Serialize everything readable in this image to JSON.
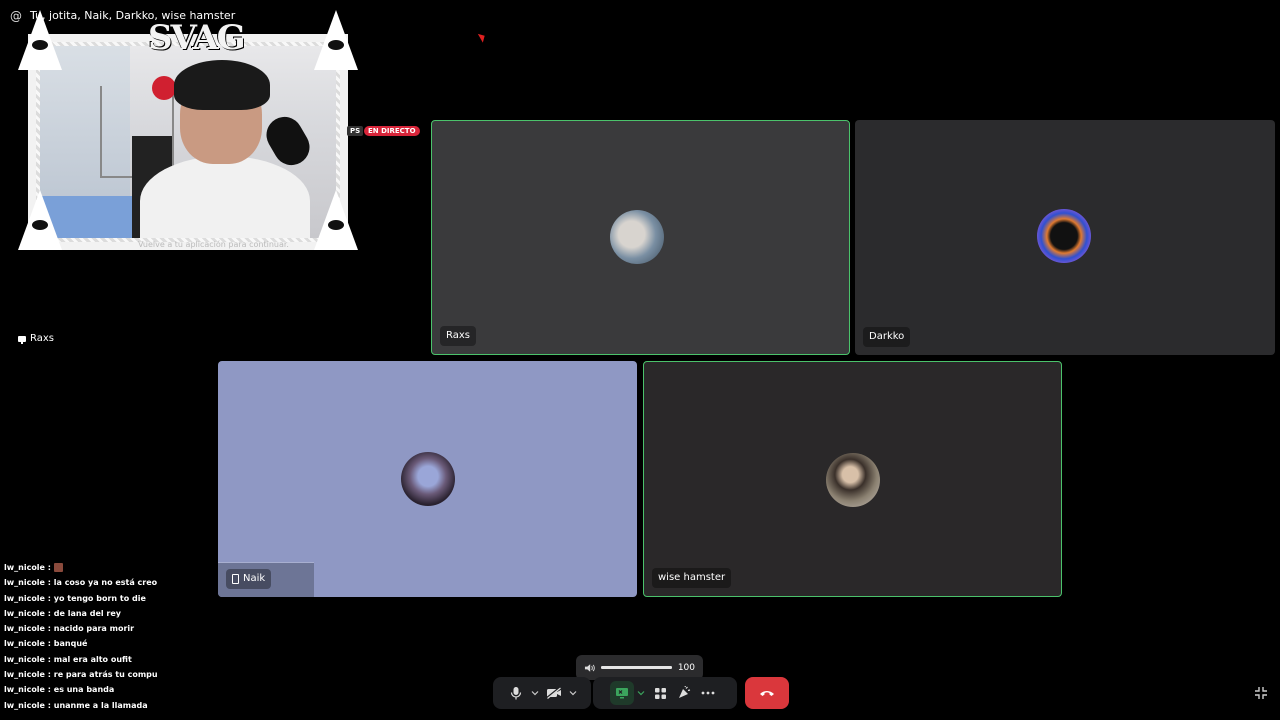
{
  "window": {
    "at_symbol": "@",
    "title": "Tu, jotita, Naik, Darkko, wise hamster"
  },
  "stream_overlay": {
    "logo_text": "SVAG",
    "caption": "Vuelve a tu aplicación para continuar.",
    "badge_ps": "PS",
    "badge_live": "EN DIRECTO",
    "streamer_label": "Raxs"
  },
  "tiles": [
    {
      "name": "Raxs",
      "speaking": true,
      "bg": "#3a3a3c"
    },
    {
      "name": "Darkko",
      "speaking": false,
      "bg": "#2b2b2d"
    },
    {
      "name": "Naik",
      "speaking": false,
      "bg": "#8f98c4",
      "device": "phone-icon"
    },
    {
      "name": "wise hamster",
      "speaking": true,
      "bg": "#2a2829"
    }
  ],
  "chat": [
    {
      "user": "lw_nicole",
      "sep": " : ",
      "text": "",
      "emoji": true
    },
    {
      "user": "lw_nicole",
      "sep": " : ",
      "text": "la coso ya no está creo"
    },
    {
      "user": "lw_nicole",
      "sep": " : ",
      "text": "yo tengo born to die"
    },
    {
      "user": "lw_nicole",
      "sep": " : ",
      "text": "de lana del rey"
    },
    {
      "user": "lw_nicole",
      "sep": " : ",
      "text": "nacido para morir"
    },
    {
      "user": "lw_nicole",
      "sep": " : ",
      "text": "banqué"
    },
    {
      "user": "lw_nicole",
      "sep": " : ",
      "text": "mal era alto oufit"
    },
    {
      "user": "lw_nicole",
      "sep": " : ",
      "text": "re para atrás tu compu"
    },
    {
      "user": "lw_nicole",
      "sep": " : ",
      "text": "es una banda"
    },
    {
      "user": "lw_nicole",
      "sep": " : ",
      "text": "unanme a la llamada"
    }
  ],
  "volume": {
    "value": "100",
    "level": 1.0
  },
  "controls": {
    "audio": [
      "microphone-icon",
      "chevron-down-icon",
      "camera-off-icon",
      "chevron-down-icon"
    ],
    "share": [
      "screen-share-icon",
      "chevron-down-icon",
      "activities-icon",
      "soundboard-icon",
      "more-icon"
    ],
    "hangup": "phone-hangup-icon",
    "collapse": "collapse-icon"
  },
  "colors": {
    "speaking_border": "#4bc26b",
    "hangup": "#da373c",
    "live_badge": "#d8253a"
  }
}
